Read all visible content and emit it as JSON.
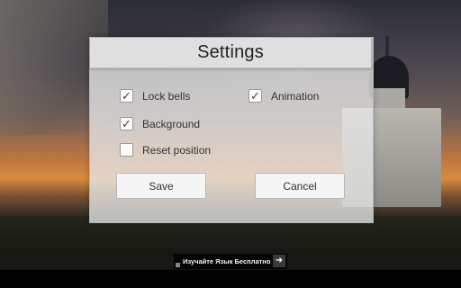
{
  "dialog": {
    "title": "Settings",
    "options": [
      {
        "label": "Lock bells",
        "checked": true,
        "check_glyph": "✓"
      },
      {
        "label": "Animation",
        "checked": true,
        "check_glyph": "✓"
      },
      {
        "label": "Background",
        "checked": true,
        "check_glyph": "✓"
      },
      {
        "label": "Reset position",
        "checked": false,
        "check_glyph": ""
      }
    ],
    "save_label": "Save",
    "cancel_label": "Cancel"
  },
  "ad": {
    "text": "Изучайте Язык Бесплатно",
    "arrow_glyph": "➜",
    "arrow_icon": "arrow-right-icon"
  },
  "colors": {
    "dialog_bg": "#e8e8e8",
    "header_bg": "#e0e0e0",
    "button_bg": "#f5f5f5",
    "ad_bg": "#050505"
  }
}
